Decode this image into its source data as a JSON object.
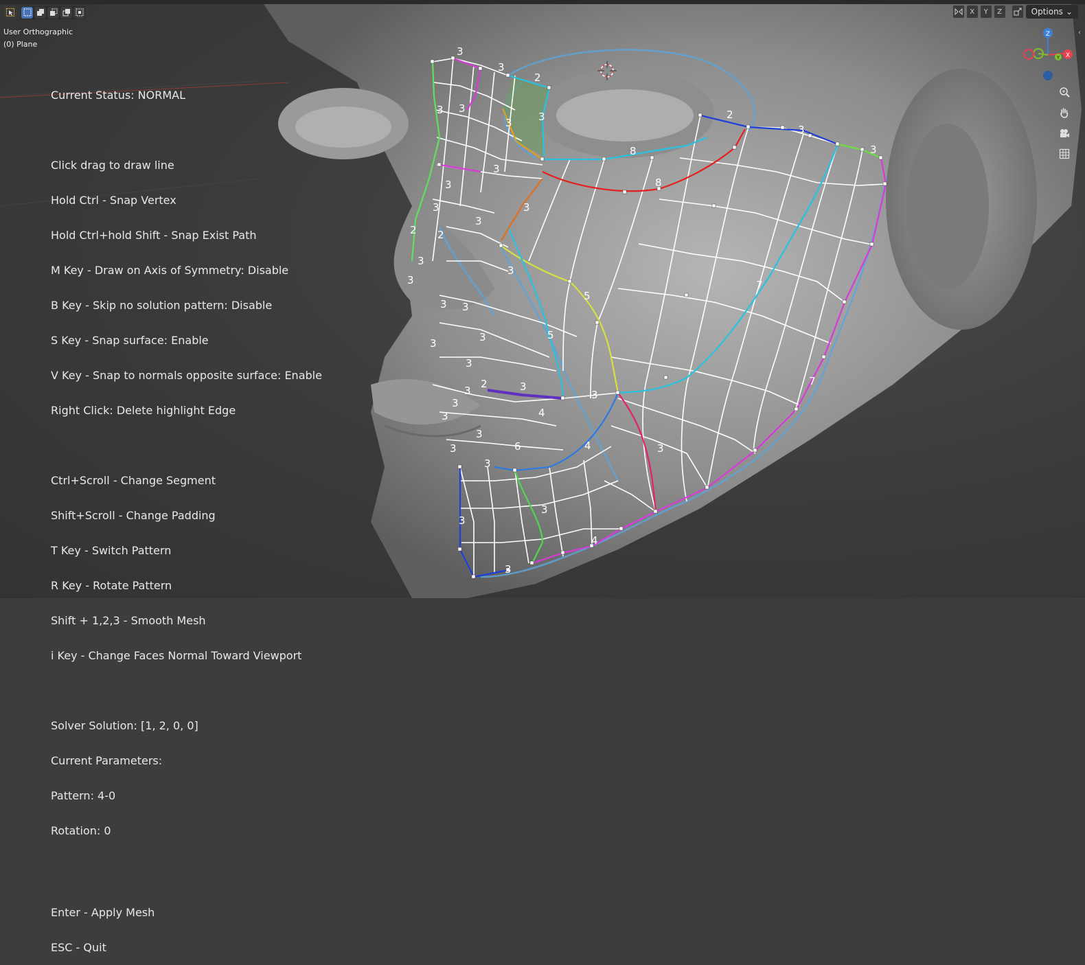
{
  "viewport": {
    "view_name": "User Orthographic",
    "object_name": "(0) Plane"
  },
  "status": {
    "line_current": "Current Status: NORMAL",
    "help": [
      "Click drag to draw line",
      "Hold Ctrl - Snap Vertex",
      "Hold Ctrl+hold Shift - Snap Exist Path",
      "M Key - Draw on Axis of Symmetry: Disable",
      "B Key - Skip no solution pattern: Disable",
      "S Key - Snap surface: Enable",
      "V Key - Snap to normals opposite surface: Enable",
      "Right Click: Delete highlight Edge"
    ],
    "controls": [
      "Ctrl+Scroll - Change Segment",
      "Shift+Scroll - Change Padding",
      "T Key - Switch Pattern",
      "R Key - Rotate Pattern",
      "Shift + 1,2,3 - Smooth Mesh",
      "i Key - Change Faces Normal Toward Viewport"
    ],
    "solver": [
      "Solver Solution: [1, 2, 0, 0]",
      "Current Parameters:",
      "Pattern: 4-0",
      "Rotation: 0"
    ],
    "actions": [
      "Enter - Apply Mesh",
      "ESC - Quit"
    ]
  },
  "header": {
    "axis_x": "X",
    "axis_y": "Y",
    "axis_z": "Z",
    "options_label": "Options"
  },
  "gizmo": {
    "z": "Z",
    "y": "Y",
    "x": "X"
  },
  "segment_labels": [
    "3",
    "3",
    "2",
    "3",
    "3",
    "3",
    "2",
    "3",
    "3",
    "8",
    "8",
    "3",
    "3",
    "3",
    "3",
    "2",
    "2",
    "3",
    "3",
    "5",
    "3",
    "3",
    "3",
    "3",
    "3",
    "5",
    "3",
    "3",
    "7",
    "3",
    "2",
    "3",
    "3",
    "3",
    "4",
    "3",
    "3",
    "3",
    "6",
    "4",
    "3",
    "3",
    "3",
    "3",
    "3",
    "4",
    "3",
    "7"
  ],
  "colors": {
    "select_blue": "#4772b3",
    "axis_x": "#e8414f",
    "axis_y": "#7fbf2d",
    "axis_z": "#3b82d6",
    "mesh_white": "#ffffff"
  }
}
